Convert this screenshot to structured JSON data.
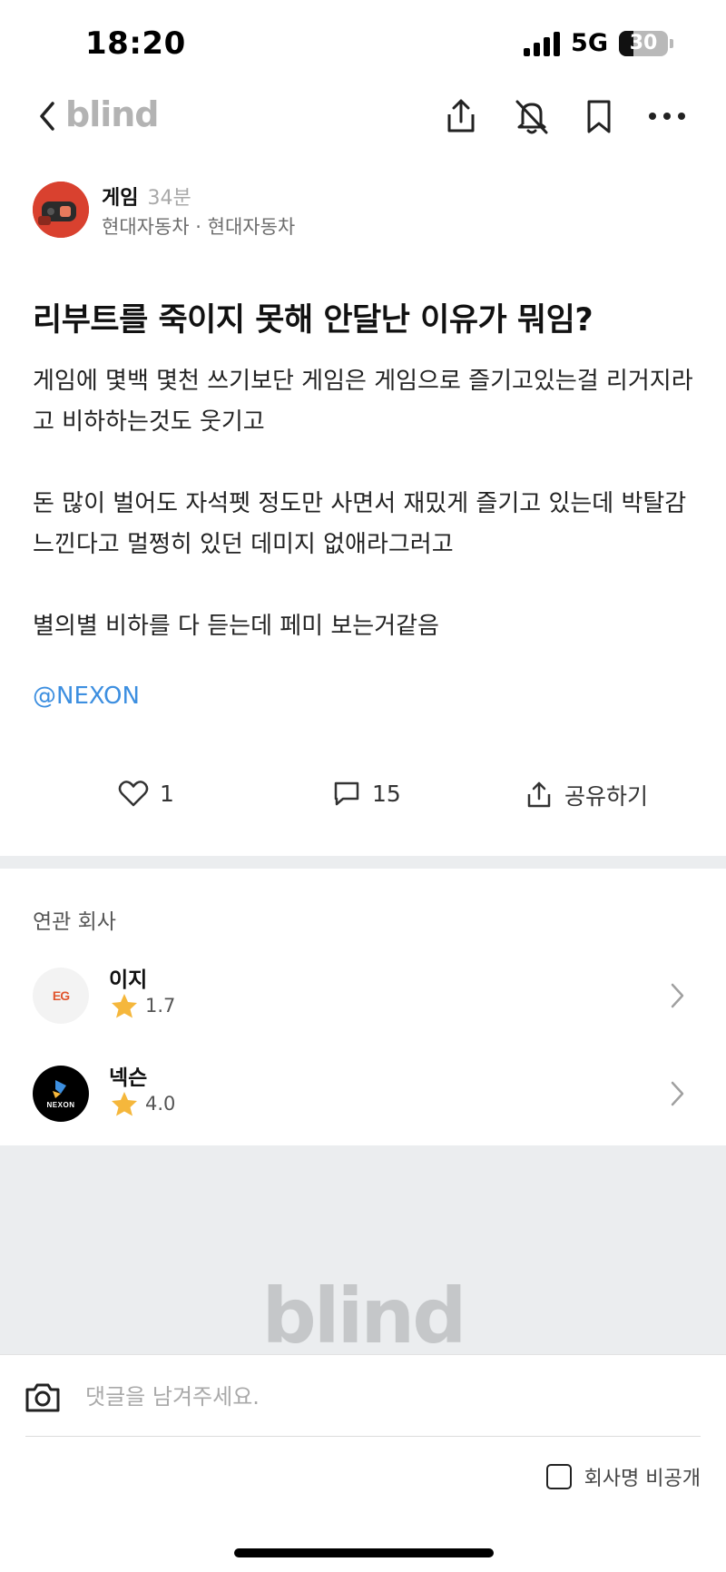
{
  "status_bar": {
    "time": "18:20",
    "network": "5G",
    "battery": "30"
  },
  "nav": {
    "logo": "blind",
    "icons": [
      "back-icon",
      "share-icon",
      "bell-off-icon",
      "bookmark-icon",
      "more-icon"
    ]
  },
  "author": {
    "category": "게임",
    "time_ago": "34분",
    "company_line": "현대자동차 · 현대자동차"
  },
  "post": {
    "title": "리부트를 죽이지 못해 안달난 이유가 뭐임?",
    "paragraphs": [
      "게임에 몇백 몇천 쓰기보단 게임은 게임으로 즐기고있는걸 리거지라고 비하하는것도 웃기고",
      "돈 많이 벌어도 자석펫 정도만 사면서 재밌게 즐기고 있는데 박탈감느낀다고 멀쩡히 있던 데미지 없애라그러고",
      "별의별 비하를 다 듣는데 페미 보는거같음"
    ],
    "mention": "@NEXON"
  },
  "actions": {
    "likes": "1",
    "comments": "15",
    "share_label": "공유하기"
  },
  "related": {
    "title": "연관 회사",
    "companies": [
      {
        "name": "이지",
        "rating": "1.7",
        "logo_text": "EG"
      },
      {
        "name": "넥슨",
        "rating": "4.0",
        "logo_text": "NEXON"
      }
    ]
  },
  "footer": {
    "logo": "blind"
  },
  "comment_bar": {
    "placeholder": "댓글을 남겨주세요.",
    "anonymous_label": "회사명 비공개"
  },
  "colors": {
    "accent_link": "#3d8fe0",
    "avatar_bg": "#d9412f",
    "star": "#f5b73c",
    "divider_gray": "#ebedef"
  }
}
